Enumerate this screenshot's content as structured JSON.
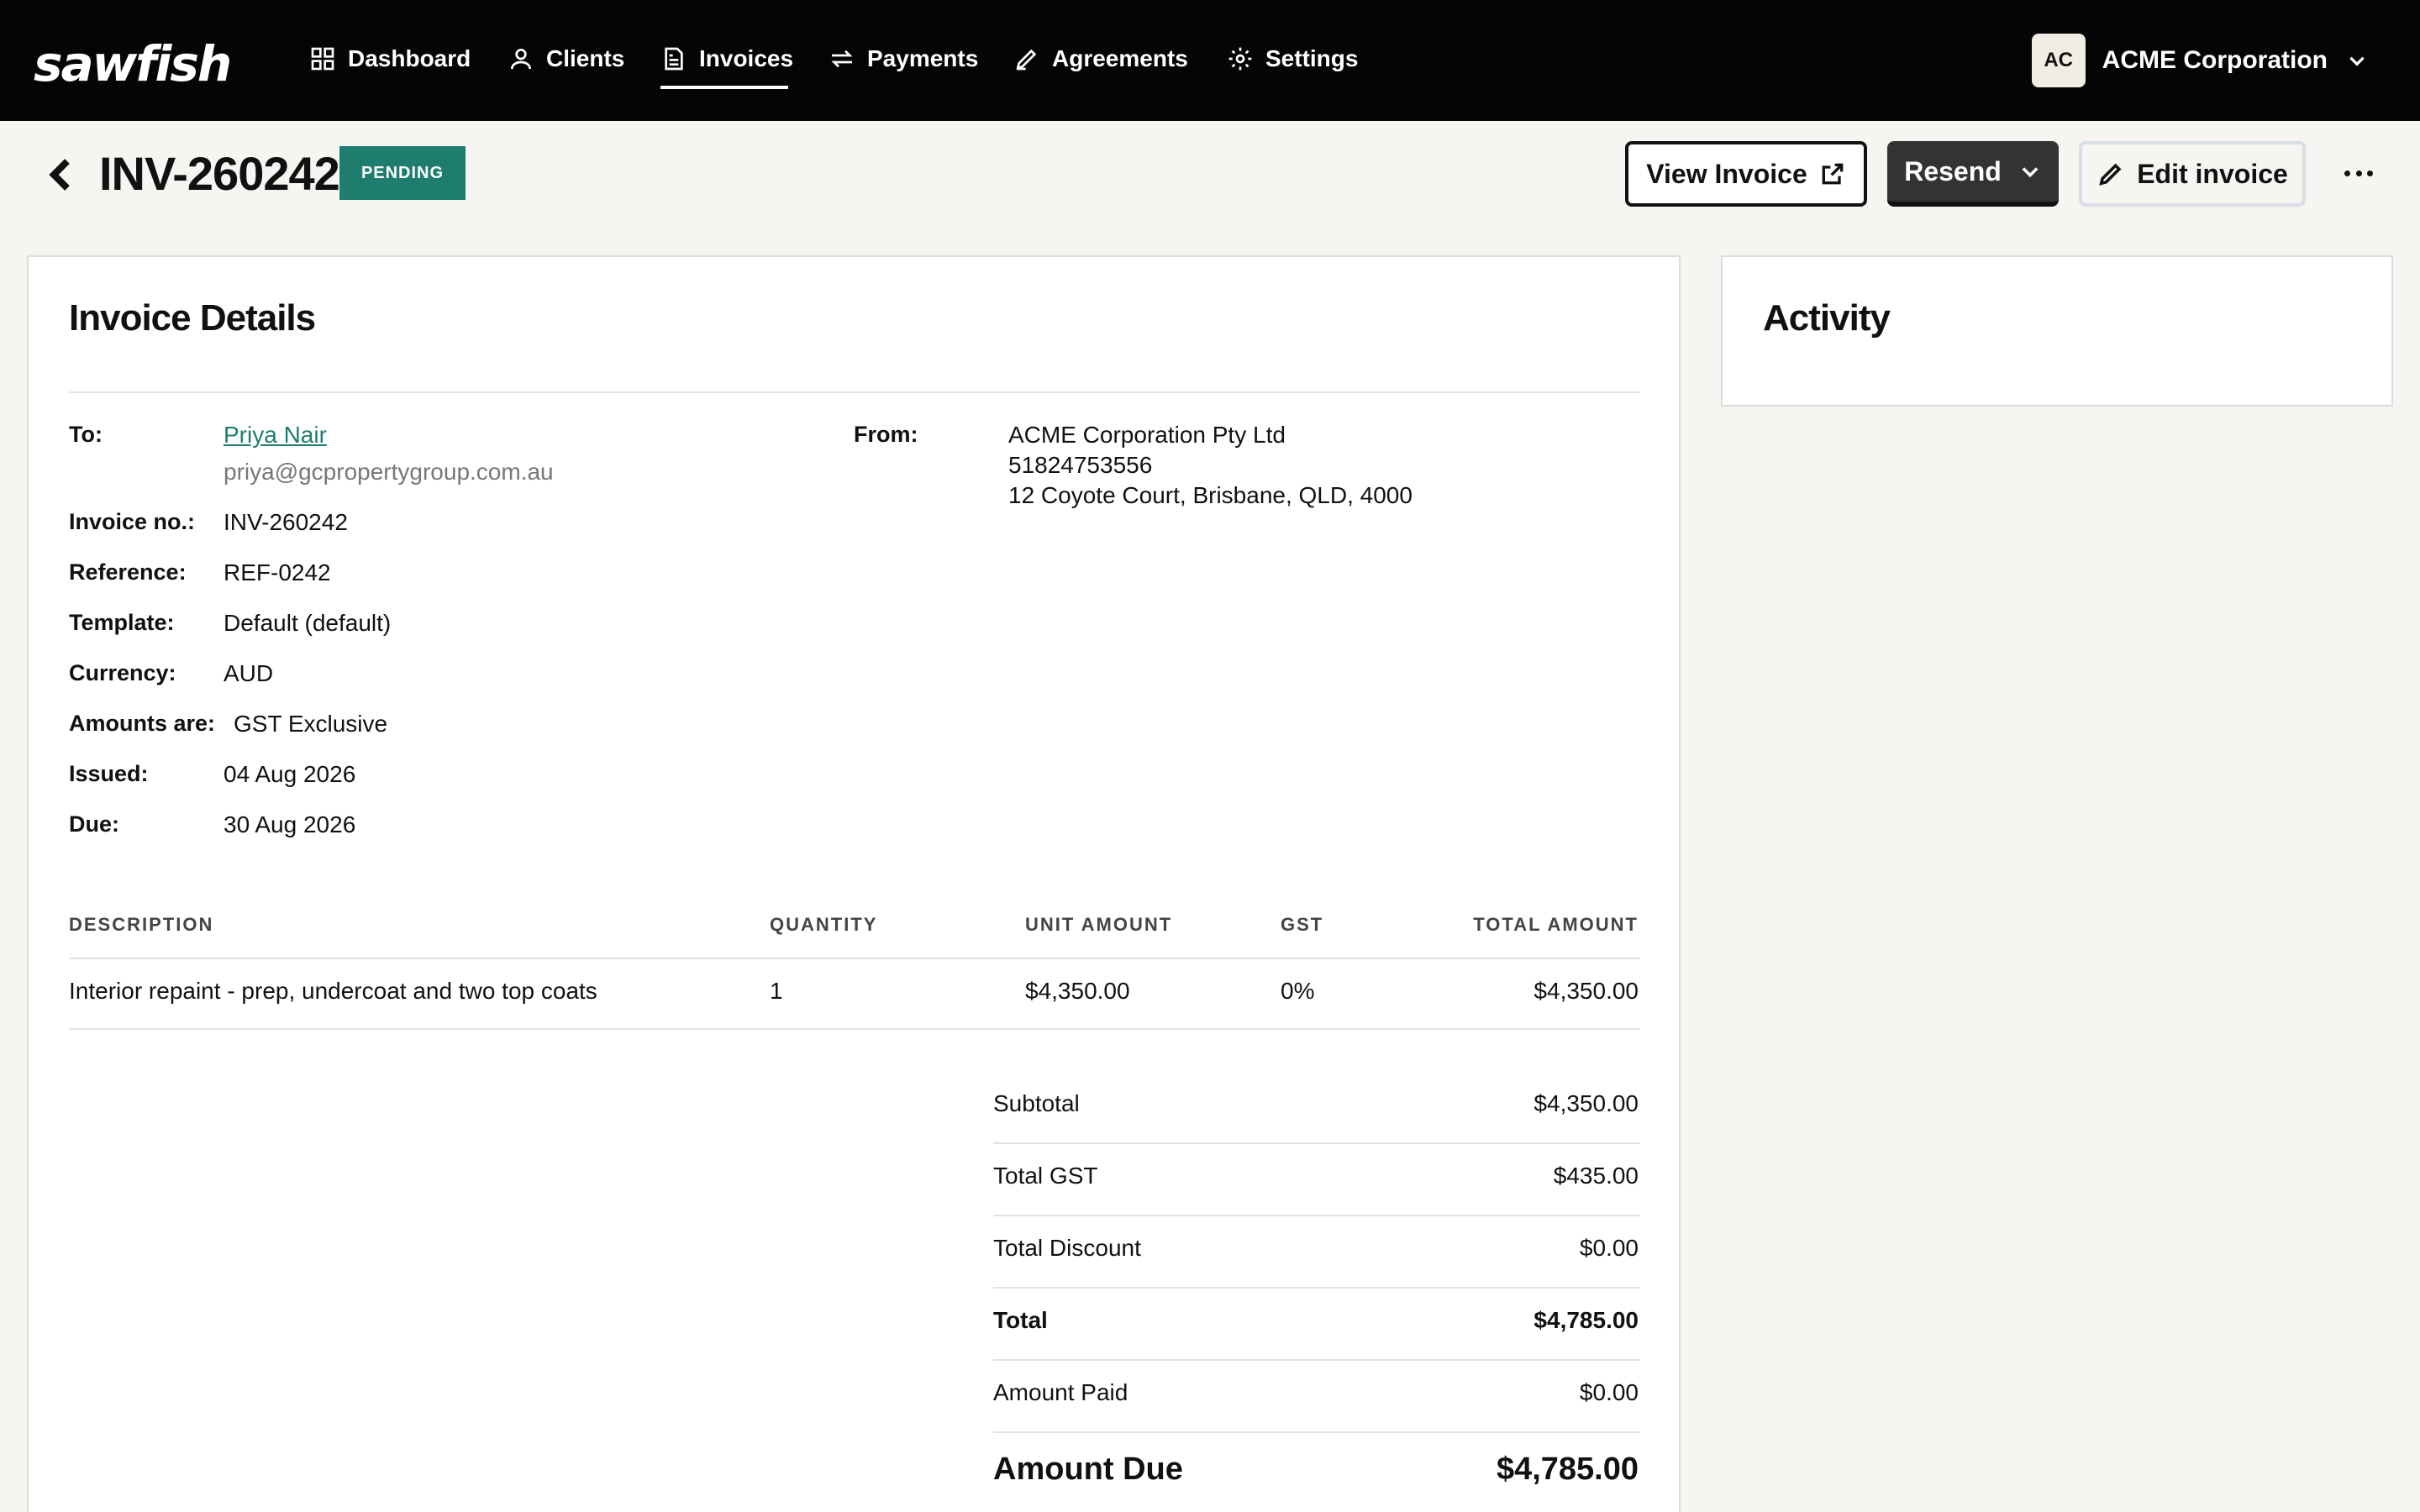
{
  "nav": {
    "logo": "sawfish",
    "items": [
      {
        "label": "Dashboard",
        "icon": "grid-icon"
      },
      {
        "label": "Clients",
        "icon": "user-icon"
      },
      {
        "label": "Invoices",
        "icon": "invoice-icon"
      },
      {
        "label": "Payments",
        "icon": "arrows-icon"
      },
      {
        "label": "Agreements",
        "icon": "pen-icon"
      },
      {
        "label": "Settings",
        "icon": "gear-icon"
      }
    ],
    "active": "Invoices",
    "account": {
      "initials": "AC",
      "name": "ACME Corporation"
    }
  },
  "header": {
    "title": "INV-260242",
    "status": "PENDING",
    "status_color": "#1f7d6f",
    "view_label": "View Invoice",
    "resend_label": "Resend",
    "edit_label": "Edit invoice"
  },
  "details": {
    "title": "Invoice Details",
    "to_label": "To:",
    "to_name": "Priya Nair",
    "to_email": "priya@gcpropertygroup.com.au",
    "from_label": "From:",
    "from_lines": [
      "ACME Corporation Pty Ltd",
      "51824753556",
      "12 Coyote Court, Brisbane, QLD, 4000"
    ],
    "fields": [
      {
        "label": "Invoice no.:",
        "value": "INV-260242"
      },
      {
        "label": "Reference:",
        "value": "REF-0242"
      },
      {
        "label": "Template:",
        "value": "Default (default)"
      },
      {
        "label": "Currency:",
        "value": "AUD"
      },
      {
        "label": "Amounts are:",
        "value": "GST Exclusive"
      },
      {
        "label": "Issued:",
        "value": "04 Aug 2026"
      },
      {
        "label": "Due:",
        "value": "30 Aug 2026"
      }
    ],
    "table": {
      "headers": [
        "DESCRIPTION",
        "QUANTITY",
        "UNIT AMOUNT",
        "GST",
        "TOTAL AMOUNT"
      ],
      "rows": [
        [
          "Interior repaint - prep, undercoat and two top coats",
          "1",
          "$4,350.00",
          "0%",
          "$4,350.00"
        ]
      ]
    },
    "summary": [
      {
        "label": "Subtotal",
        "value": "$4,350.00"
      },
      {
        "label": "Total GST",
        "value": "$435.00"
      },
      {
        "label": "Total Discount",
        "value": "$0.00"
      },
      {
        "label": "Total",
        "value": "$4,785.00"
      },
      {
        "label": "Amount Paid",
        "value": "$0.00"
      },
      {
        "label": "Amount Due",
        "value": "$4,785.00"
      }
    ]
  },
  "activity": {
    "title": "Activity"
  }
}
